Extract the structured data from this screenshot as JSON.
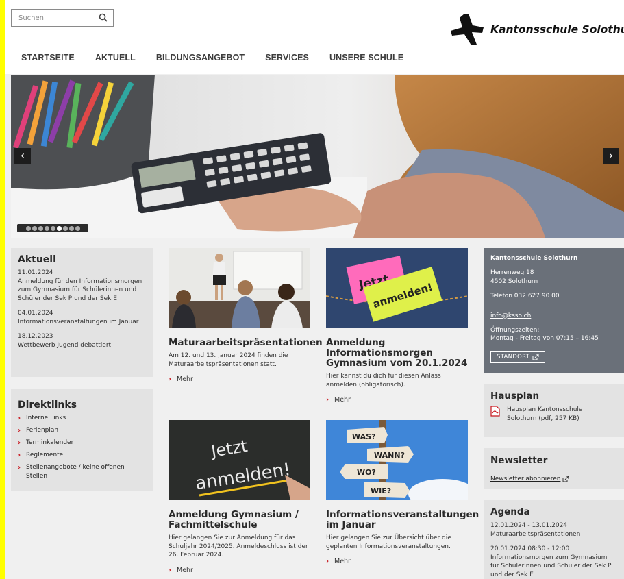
{
  "search": {
    "placeholder": "Suchen"
  },
  "logo": {
    "text": "Kantonsschule Solothurn"
  },
  "nav": {
    "items": [
      "STARTSEITE",
      "AKTUELL",
      "BILDUNGSANGEBOT",
      "SERVICES",
      "UNSERE SCHULE"
    ]
  },
  "hero": {
    "prev": "‹",
    "next": "›",
    "slides_total": 9,
    "active_slide": 6
  },
  "aktuell": {
    "title": "Aktuell",
    "entries": [
      {
        "date": "11.01.2024",
        "text": "Anmeldung für den Informationsmorgen zum Gymnasium für Schülerinnen und Schüler der Sek P und der Sek E"
      },
      {
        "date": "04.01.2024",
        "text": "Informationsveranstaltungen im Januar"
      },
      {
        "date": "18.12.2023",
        "text": "Wettbewerb Jugend debattiert"
      }
    ]
  },
  "direktlinks": {
    "title": "Direktlinks",
    "items": [
      "Interne Links",
      "Ferienplan",
      "Terminkalender",
      "Reglemente",
      "Stellenangebote / keine offenen Stellen"
    ]
  },
  "cards": [
    {
      "title_lines": [
        "Maturaarbeitspräsentationen"
      ],
      "text_lines": [
        "Am 12. und 13. Januar 2024 finden die",
        "Maturaarbeitspräsentationen statt."
      ],
      "more": "Mehr"
    },
    {
      "title_lines": [
        "Anmeldung",
        "Informationsmorgen",
        "Gymnasium vom 20.1.2024"
      ],
      "text_lines": [
        "Hier kannst du dich für diesen Anlass",
        "anmelden (obligatorisch)."
      ],
      "more": "Mehr"
    },
    {
      "title_lines": [
        "Anmeldung Gymnasium /",
        "Fachmittelschule"
      ],
      "text_lines": [
        "Hier gelangen Sie zur Anmeldung für das",
        "Schuljahr 2024/2025. Anmeldeschluss ist der",
        "26. Februar 2024."
      ],
      "more": "Mehr",
      "image_text": [
        "Jetzt",
        "anmelden!"
      ]
    },
    {
      "title_lines": [
        "Informationsveranstaltungen",
        "im Januar"
      ],
      "text_lines": [
        "Hier gelangen Sie zur Übersicht über die",
        "geplanten Informationsveranstaltungen."
      ],
      "more": "Mehr",
      "image_text": [
        "WAS?",
        "WANN?",
        "WO?",
        "WIE?"
      ]
    }
  ],
  "card2_image_text": [
    "Jetzt",
    "anmelden!"
  ],
  "contact": {
    "title": "Kantonsschule Solothurn",
    "street": "Herrenweg 18",
    "city": "4502 Solothurn",
    "phone": "Telefon 032 627 90 00",
    "email": "info@ksso.ch",
    "hours_label": "Öffnungszeiten:",
    "hours": "Montag - Freitag von 07:15 – 16:45",
    "button": "STANDORT"
  },
  "hausplan": {
    "title": "Hausplan",
    "file_line1": "Hausplan Kantonsschule",
    "file_line2": "Solothurn  (pdf, 257 KB)"
  },
  "newsletter": {
    "title": "Newsletter",
    "link": "Newsletter abonnieren"
  },
  "agenda": {
    "title": "Agenda",
    "entries": [
      {
        "date": "12.01.2024 - 13.01.2024",
        "lines": [
          "Maturaarbeitspräsentationen"
        ]
      },
      {
        "date": "20.01.2024 08:30 - 12:00",
        "lines": [
          "Informationsmorgen zum Gymnasium",
          "für Schülerinnen und Schüler der Sek P",
          "und der Sek E"
        ]
      }
    ]
  },
  "colors": {
    "accent": "#c8161d",
    "contact_bg": "#6a7079",
    "box_bg": "#e3e3e3",
    "page_frame": "#ffff00"
  }
}
